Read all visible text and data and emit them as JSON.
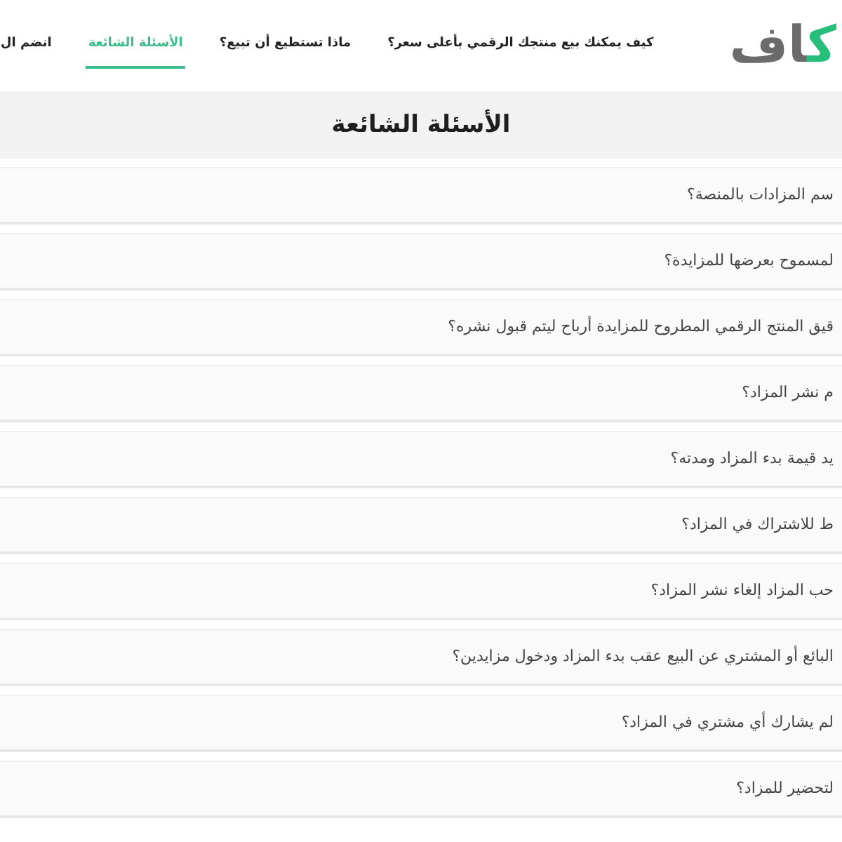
{
  "logo": {
    "accent": "ك",
    "text": "اف"
  },
  "nav": {
    "items": [
      {
        "label": "كيف يمكنك بيع منتجك الرقمي بأعلى سعر؟",
        "selected": false
      },
      {
        "label": "ماذا تستطيع أن تبيع؟",
        "selected": false
      },
      {
        "label": "الأسئلة الشائعة",
        "selected": true
      },
      {
        "label": "انضم ال",
        "selected": false
      }
    ]
  },
  "heading": "الأسئلة الشائعة",
  "faq": [
    {
      "question": "سم المزادات بالمنصة؟"
    },
    {
      "question": "لمسموح بعرضها للمزايدة؟"
    },
    {
      "question": "قيق المنتج الرقمي المطروح للمزايدة أرباح ليتم قبول نشره؟"
    },
    {
      "question": "م نشر المزاد؟"
    },
    {
      "question": "يد قيمة بدء المزاد ومدته؟"
    },
    {
      "question": "ط للاشتراك في المزاد؟"
    },
    {
      "question": "حب المزاد إلغاء نشر المزاد؟"
    },
    {
      "question": "البائع أو المشتري عن البيع عقب بدء المزاد ودخول مزايدين؟"
    },
    {
      "question": "لم يشارك أي مشتري في المزاد؟"
    },
    {
      "question": "لتحضير للمزاد؟"
    }
  ]
}
